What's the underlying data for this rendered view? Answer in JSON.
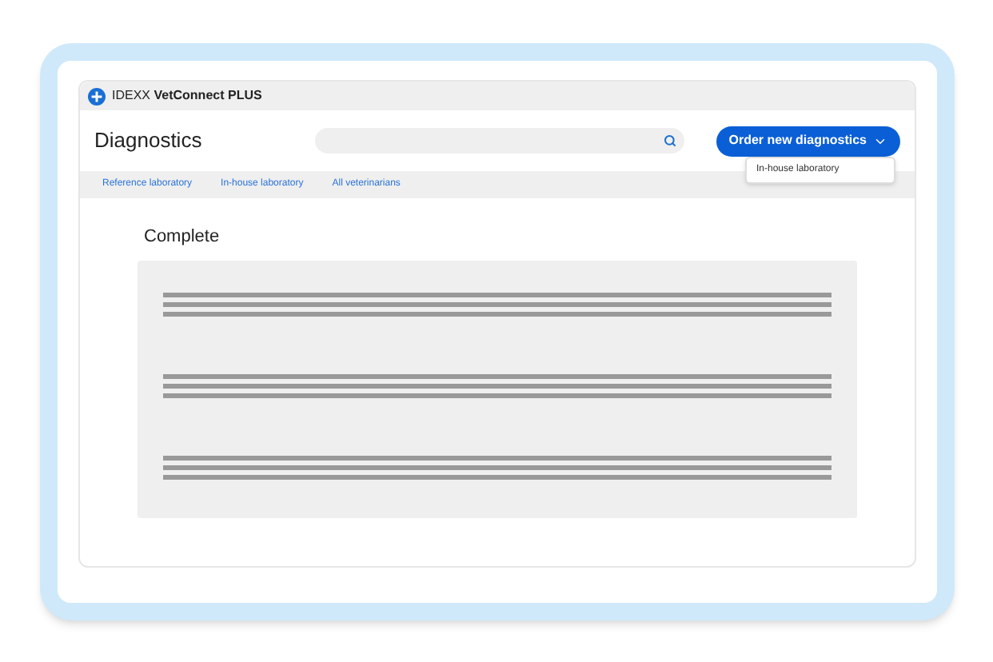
{
  "app": {
    "brand": "IDEXX",
    "product": "VetConnect PLUS"
  },
  "header": {
    "title": "Diagnostics",
    "order_button": "Order new diagnostics"
  },
  "dropdown": {
    "items": [
      "In-house laboratory"
    ]
  },
  "tabs": [
    {
      "label": "Reference laboratory",
      "selected": false
    },
    {
      "label": "In-house laboratory",
      "selected": false
    },
    {
      "label": "All veterinarians",
      "selected": false
    }
  ],
  "section": {
    "title": "Complete",
    "results": [
      {
        "kind": "placeholder"
      },
      {
        "kind": "placeholder"
      },
      {
        "kind": "placeholder"
      }
    ]
  }
}
